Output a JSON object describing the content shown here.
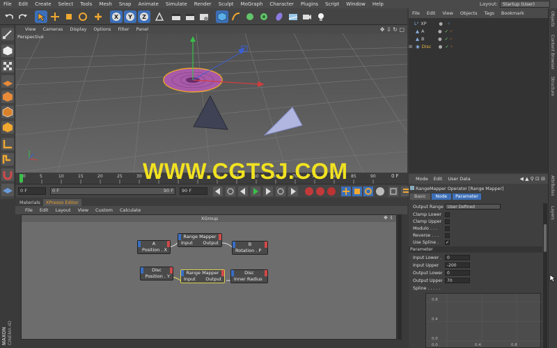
{
  "menubar": {
    "items": [
      "File",
      "Edit",
      "Create",
      "Select",
      "Tools",
      "Mesh",
      "Snap",
      "Animate",
      "Simulate",
      "Render",
      "Sculpt",
      "MoGraph",
      "Character",
      "Plugins",
      "Script",
      "Window",
      "Help"
    ],
    "layout_label": "Layout:",
    "layout_value": "Startup (User)"
  },
  "toolbar": {
    "buttons": [
      "undo-icon",
      "redo-icon",
      "select-arrow-icon",
      "move-icon",
      "scale-icon",
      "rotate-icon",
      "add-icon",
      "x-axis-icon",
      "y-axis-icon",
      "z-axis-icon",
      "world-coords-icon",
      "render-view-icon",
      "render-picture-icon",
      "render-settings-icon",
      "cube-icon",
      "spline-pen-icon",
      "nurbs-icon",
      "array-icon",
      "deformer-icon",
      "scene-floor-icon",
      "camera-icon",
      "light-icon"
    ]
  },
  "viewport": {
    "menu": [
      "View",
      "Cameras",
      "Display",
      "Options",
      "Filter",
      "Panel"
    ],
    "label": "Perspective"
  },
  "timeline": {
    "ticks": [
      "0",
      "5",
      "10",
      "15",
      "20",
      "25",
      "30",
      "35",
      "40",
      "45",
      "50",
      "55",
      "60",
      "65",
      "70",
      "75",
      "80",
      "85",
      "90"
    ],
    "current_frame": "0 F",
    "start_field": "0 F",
    "end_field": "90 F",
    "max_field": "90 F"
  },
  "object_manager": {
    "menu": [
      "File",
      "Edit",
      "View",
      "Objects",
      "Tags",
      "Bookmark"
    ],
    "objects": [
      {
        "name": "XP",
        "color": "#e0e0e0"
      },
      {
        "name": "A",
        "color": "#e0e0e0"
      },
      {
        "name": "B",
        "color": "#e0e0e0"
      },
      {
        "name": "Disc",
        "color": "#e8b84a"
      }
    ]
  },
  "side_tabs": [
    "Objects",
    "Content Browser",
    "Structure",
    "Attributes",
    "Layers"
  ],
  "attributes": {
    "menu": [
      "Mode",
      "Edit",
      "User Data"
    ],
    "title": "RangeMapper Operator [Range Mapper]",
    "tabs": [
      "Basic",
      "Node",
      "Parameter"
    ],
    "output_range_label": "Output Range",
    "output_range_value": "User Defined",
    "checks": [
      {
        "label": "Clamp Lower",
        "checked": ""
      },
      {
        "label": "Clamp Upper",
        "checked": ""
      },
      {
        "label": "Modulo . . .",
        "checked": ""
      },
      {
        "label": "Reverse . . .",
        "checked": ""
      },
      {
        "label": "Use Spline .",
        "checked": "✓"
      }
    ],
    "section": "Parameter",
    "params": [
      {
        "label": "Input Lower . .",
        "value": "0"
      },
      {
        "label": "Input Upper",
        "value": "-200"
      },
      {
        "label": "Output Lower",
        "value": "0"
      },
      {
        "label": "Output Upper",
        "value": "70"
      }
    ],
    "spline_label": "Spline . . . . .",
    "graph_y_ticks": [
      "0.8",
      "0.4",
      "0.0"
    ],
    "graph_x_ticks": [
      "0.0",
      "0.4",
      "0.8"
    ]
  },
  "xpresso": {
    "tabs": [
      "Materials",
      "XPresso Editor"
    ],
    "menu": [
      "File",
      "Edit",
      "Layout",
      "View",
      "Custom",
      "Calculate"
    ],
    "group_title": "XGroup",
    "nodes": {
      "a": {
        "title": "A",
        "port": "Position . X"
      },
      "rm1": {
        "title": "Range Mapper",
        "in": "Input",
        "out": "Output"
      },
      "b": {
        "title": "B",
        "port": "Rotation . P"
      },
      "disc1": {
        "title": "Disc",
        "port": "Position . Y"
      },
      "rm2": {
        "title": "Range Mapper",
        "in": "Input",
        "out": "Output"
      },
      "disc2": {
        "title": "Disc",
        "port": "Inner Radius"
      }
    }
  },
  "logo": {
    "line1": "MAXON",
    "line2": "CINEMA 4D"
  },
  "watermark": "WWW.CGTSJ.COM",
  "colors": {
    "accent_orange": "#d98a28",
    "selection_blue": "#3c6fb8",
    "disc_pink": "#b25fb5"
  }
}
